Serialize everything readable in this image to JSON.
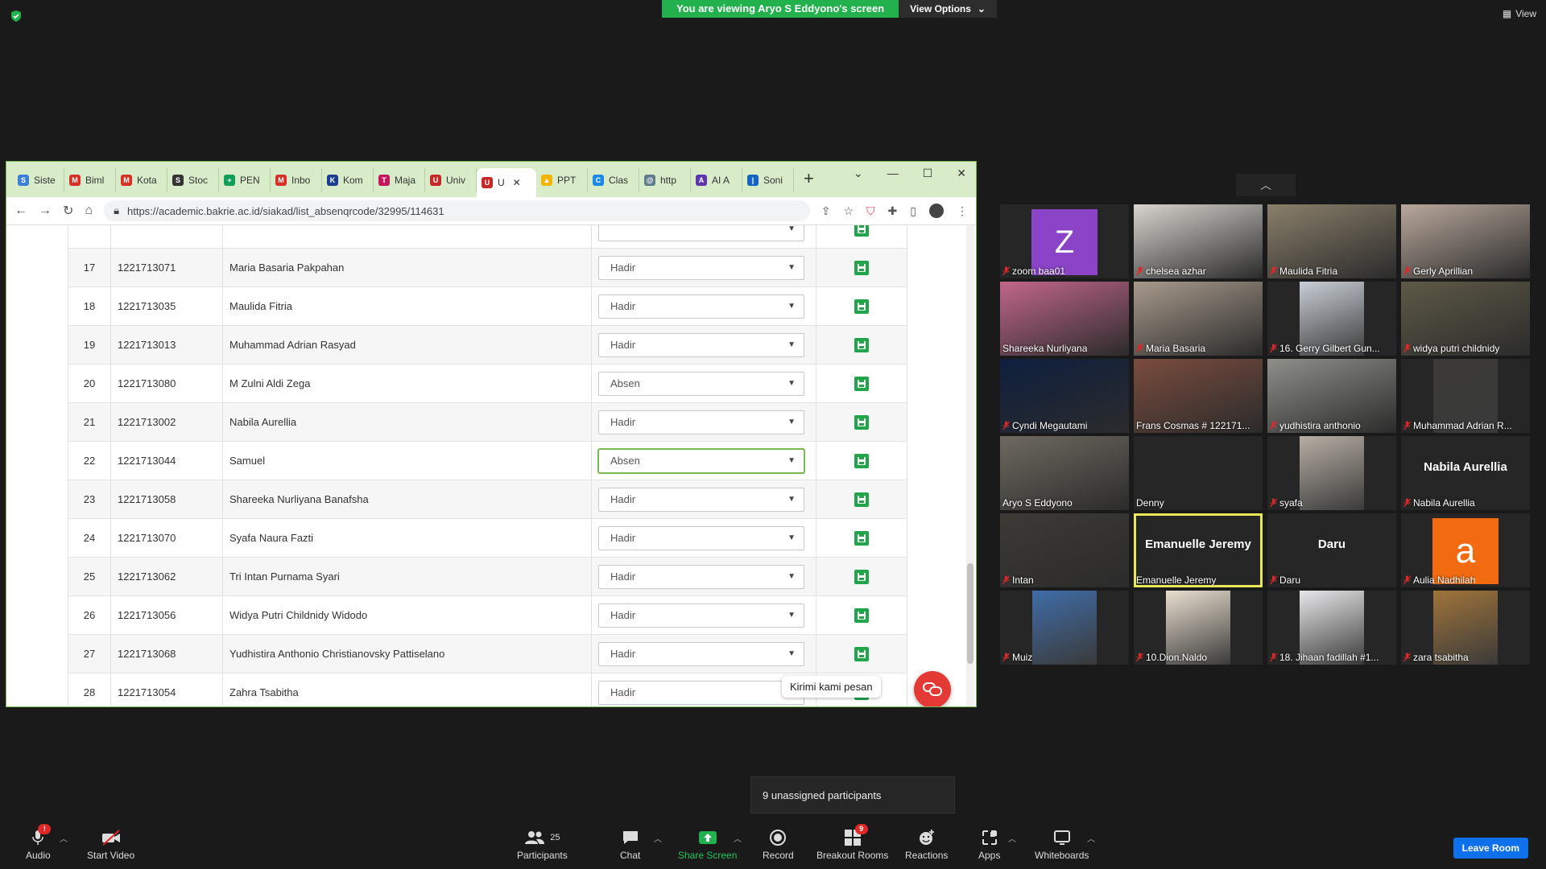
{
  "share_banner": {
    "viewing_text": "You are viewing Aryo S Eddyono's screen",
    "view_options": "View Options"
  },
  "top_right": {
    "view_label": "View"
  },
  "browser": {
    "tabs": [
      {
        "label": "Siste",
        "color": "#3c7fd6",
        "glyph": "S"
      },
      {
        "label": "Biml",
        "color": "#d93025",
        "glyph": "M"
      },
      {
        "label": "Kota",
        "color": "#d93025",
        "glyph": "M"
      },
      {
        "label": "Stoc",
        "color": "#333333",
        "glyph": "S"
      },
      {
        "label": "PEN",
        "color": "#0f9d58",
        "glyph": "+"
      },
      {
        "label": "Inbo",
        "color": "#d93025",
        "glyph": "M"
      },
      {
        "label": "Kom",
        "color": "#1a3d8f",
        "glyph": "K"
      },
      {
        "label": "Maja",
        "color": "#c2185b",
        "glyph": "T"
      },
      {
        "label": "Univ",
        "color": "#c62828",
        "glyph": "U"
      },
      {
        "label": "U",
        "color": "#c62828",
        "glyph": "U",
        "active": true
      },
      {
        "label": "PPT",
        "color": "#f4b400",
        "glyph": "▲"
      },
      {
        "label": "Clas",
        "color": "#1e88e5",
        "glyph": "C"
      },
      {
        "label": "http",
        "color": "#607d8b",
        "glyph": "@"
      },
      {
        "label": "AI A",
        "color": "#5e35b1",
        "glyph": "A"
      },
      {
        "label": "Soni",
        "color": "#1565c0",
        "glyph": "|"
      }
    ],
    "url": "https://academic.bakrie.ac.id/siakad/list_absenqrcode/32995/114631"
  },
  "attendance": {
    "rows": [
      {
        "no": "",
        "nim": "",
        "name": "",
        "status": "",
        "partial": true
      },
      {
        "no": "17",
        "nim": "1221713071",
        "name": "Maria Basaria Pakpahan",
        "status": "Hadir"
      },
      {
        "no": "18",
        "nim": "1221713035",
        "name": "Maulida Fitria",
        "status": "Hadir"
      },
      {
        "no": "19",
        "nim": "1221713013",
        "name": "Muhammad Adrian Rasyad",
        "status": "Hadir"
      },
      {
        "no": "20",
        "nim": "1221713080",
        "name": "M Zulni Aldi Zega",
        "status": "Absen"
      },
      {
        "no": "21",
        "nim": "1221713002",
        "name": "Nabila Aurellia",
        "status": "Hadir"
      },
      {
        "no": "22",
        "nim": "1221713044",
        "name": "Samuel",
        "status": "Absen",
        "focus": true
      },
      {
        "no": "23",
        "nim": "1221713058",
        "name": "Shareeka Nurliyana Banafsha",
        "status": "Hadir"
      },
      {
        "no": "24",
        "nim": "1221713070",
        "name": "Syafa Naura Fazti",
        "status": "Hadir"
      },
      {
        "no": "25",
        "nim": "1221713062",
        "name": "Tri Intan Purnama Syari",
        "status": "Hadir"
      },
      {
        "no": "26",
        "nim": "1221713056",
        "name": "Widya Putri Childnidy Widodo",
        "status": "Hadir"
      },
      {
        "no": "27",
        "nim": "1221713068",
        "name": "Yudhistira Anthonio Christianovsky Pattiselano",
        "status": "Hadir"
      },
      {
        "no": "28",
        "nim": "1221713054",
        "name": "Zahra Tsabitha",
        "status": "Hadir"
      }
    ],
    "chat_prompt": "Kirimi kami pesan"
  },
  "gallery": {
    "tiles": [
      {
        "name": "zoom baa01",
        "muted": true,
        "kind": "avatar-z",
        "letter": "Z"
      },
      {
        "name": "chelsea azhar",
        "muted": true,
        "kind": "video",
        "bg": "#d8d4cf"
      },
      {
        "name": "Maulida Fitria",
        "muted": true,
        "kind": "video",
        "bg": "#8a7f6a"
      },
      {
        "name": "Gerly Aprillian",
        "muted": true,
        "kind": "video",
        "bg": "#b9a89c"
      },
      {
        "name": "Shareeka Nurliyana",
        "muted": false,
        "kind": "video",
        "bg": "#c2668a"
      },
      {
        "name": "Maria Basaria",
        "muted": true,
        "kind": "video",
        "bg": "#a89a8c"
      },
      {
        "name": "16. Gerry Gilbert Gun...",
        "muted": true,
        "kind": "video-narrow",
        "bg": "#c9cfd6"
      },
      {
        "name": "widya putri childnidy",
        "muted": true,
        "kind": "video",
        "bg": "#5e5a47"
      },
      {
        "name": "Cyndi Megautami",
        "muted": true,
        "kind": "video",
        "bg": "#0e1f3f"
      },
      {
        "name": "Frans Cosmas # 122171...",
        "muted": false,
        "kind": "video",
        "bg": "#7a4c3e"
      },
      {
        "name": "yudhistira anthonio",
        "muted": true,
        "kind": "video",
        "bg": "#8f8f8a"
      },
      {
        "name": "Muhammad Adrian R...",
        "muted": true,
        "kind": "video-narrow",
        "bg": "#3b3a38"
      },
      {
        "name": "Aryo S Eddyono",
        "muted": false,
        "kind": "video",
        "bg": "#6e6a60"
      },
      {
        "name": "Denny",
        "muted": false,
        "kind": "blank"
      },
      {
        "name": "syafa",
        "muted": true,
        "kind": "video-narrow",
        "bg": "#b7aea4"
      },
      {
        "name": "Nabila Aurellia",
        "muted": true,
        "kind": "name",
        "display": "Nabila Aurellia"
      },
      {
        "name": "Intan",
        "muted": true,
        "kind": "video",
        "bg": "#3d3a36"
      },
      {
        "name": "Emanuelle Jeremy",
        "muted": false,
        "kind": "name",
        "display": "Emanuelle Jeremy",
        "speaking": true
      },
      {
        "name": "Daru",
        "muted": true,
        "kind": "name",
        "display": "Daru"
      },
      {
        "name": "Aulia Nadhilah",
        "muted": true,
        "kind": "avatar-a",
        "letter": "a"
      },
      {
        "name": "Muiz",
        "muted": true,
        "kind": "video-narrow",
        "bg": "#3f6da8"
      },
      {
        "name": "10.Dion.Naldo",
        "muted": true,
        "kind": "video-narrow",
        "bg": "#e9dfcf"
      },
      {
        "name": "18. Jihaan fadillah #1...",
        "muted": true,
        "kind": "video-narrow",
        "bg": "#e8e8ea"
      },
      {
        "name": "zara tsabitha",
        "muted": true,
        "kind": "video-narrow",
        "bg": "#a0743a"
      }
    ]
  },
  "unassigned": "9 unassigned participants",
  "toolbar": {
    "audio": "Audio",
    "audio_badge": "!",
    "start_video": "Start Video",
    "participants": "Participants",
    "participants_count": "25",
    "chat": "Chat",
    "share_screen": "Share Screen",
    "record": "Record",
    "breakout_rooms": "Breakout Rooms",
    "breakout_badge": "9",
    "reactions": "Reactions",
    "apps": "Apps",
    "whiteboards": "Whiteboards",
    "leave_room": "Leave Room"
  },
  "colors": {
    "zoom_green": "#22b14c",
    "leave_blue": "#0e71eb",
    "speaking": "#e6e85a",
    "save_green": "#22a44a",
    "chat_red": "#e53935"
  }
}
